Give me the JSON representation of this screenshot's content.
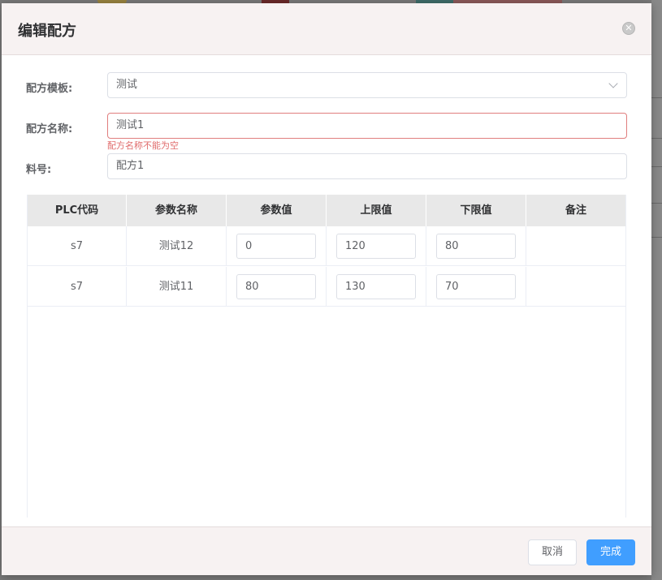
{
  "dialog": {
    "title": "编辑配方",
    "close_icon": "close-icon"
  },
  "form": {
    "template_label": "配方模板:",
    "template_value": "测试",
    "name_label": "配方名称:",
    "name_value": "测试1",
    "name_error": "配方名称不能为空",
    "material_label": "料号:",
    "material_value": "配方1"
  },
  "table": {
    "headers": [
      "PLC代码",
      "参数名称",
      "参数值",
      "上限值",
      "下限值",
      "备注"
    ],
    "rows": [
      {
        "plc": "s7",
        "name": "测试12",
        "value": "0",
        "upper": "120",
        "lower": "80",
        "note": ""
      },
      {
        "plc": "s7",
        "name": "测试11",
        "value": "80",
        "upper": "130",
        "lower": "70",
        "note": ""
      }
    ]
  },
  "footer": {
    "cancel_label": "取消",
    "ok_label": "完成"
  },
  "colors": {
    "primary": "#409eff",
    "error": "#e06c6c",
    "header_bg": "#f7f2f2"
  }
}
